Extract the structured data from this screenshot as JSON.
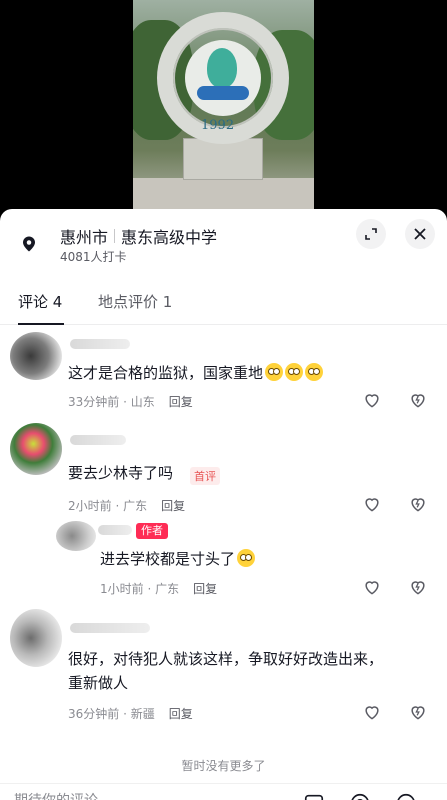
{
  "hero": {
    "monument_year": "1992"
  },
  "location": {
    "city": "惠州市",
    "place": "惠东高级中学",
    "checkins": "4081人打卡"
  },
  "tabs": [
    {
      "label": "评论 4"
    },
    {
      "label": "地点评价 1"
    }
  ],
  "comments": [
    {
      "text": "这才是合格的监狱，国家重地",
      "time": "33分钟前",
      "region": "山东",
      "reply": "回复",
      "emojis": 3
    },
    {
      "text": "要去少林寺了吗",
      "badge": "首评",
      "time": "2小时前",
      "region": "广东",
      "reply": "回复"
    },
    {
      "author_badge": "作者",
      "text": "进去学校都是寸头了",
      "time": "1小时前",
      "region": "广东",
      "reply": "回复"
    },
    {
      "text_line1": "很好，对待犯人就该这样，争取好好改造出来，",
      "text_line2": "重新做人",
      "time": "36分钟前",
      "region": "新疆",
      "reply": "回复"
    }
  ],
  "footer": {
    "no_more": "暂时没有更多了",
    "input_placeholder": "期待你的评论"
  },
  "colors": {
    "accent": "#fe2c55",
    "text": "#161823",
    "muted": "#8a8b91"
  }
}
